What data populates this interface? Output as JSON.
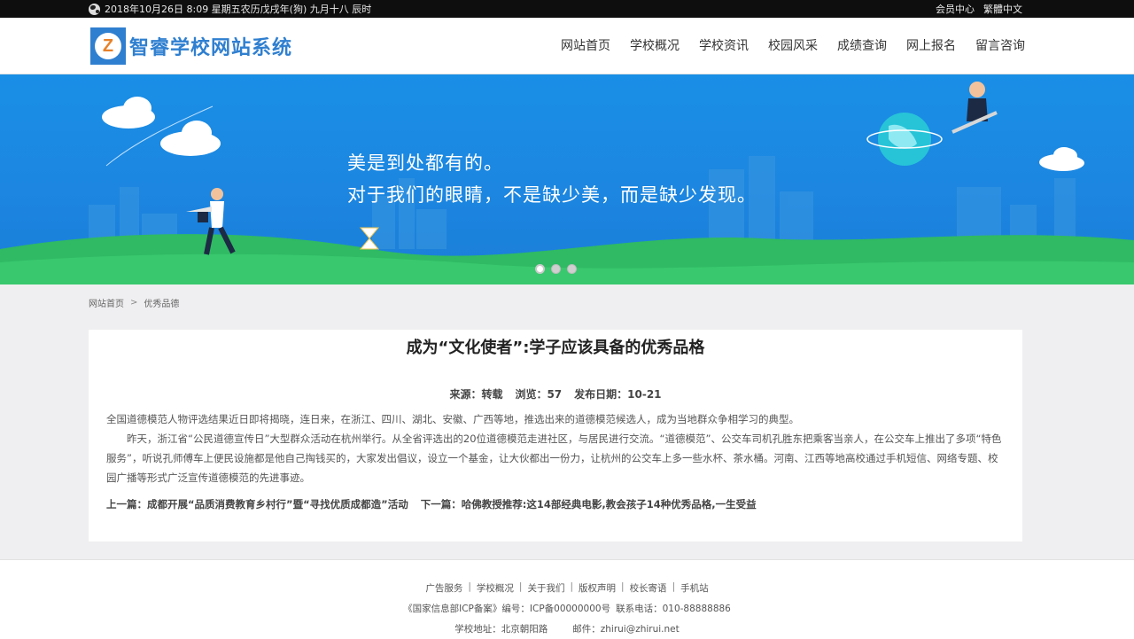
{
  "topbar": {
    "date_text": "2018年10月26日 8:09 星期五农历戊戌年(狗) 九月十八 辰时",
    "member_center": "会员中心",
    "traditional": "繁體中文"
  },
  "header": {
    "logo_letter": "Z",
    "logo_text": "智睿学校网站系统",
    "nav": [
      {
        "label": "网站首页"
      },
      {
        "label": "学校概况"
      },
      {
        "label": "学校资讯"
      },
      {
        "label": "校园风采"
      },
      {
        "label": "成绩查询"
      },
      {
        "label": "网上报名"
      },
      {
        "label": "留言咨询"
      }
    ]
  },
  "banner": {
    "line1": "美是到处都有的。",
    "line2": "对于我们的眼睛，不是缺少美，而是缺少发现。",
    "slides": 3,
    "active_slide": 1
  },
  "breadcrumb": {
    "home": "网站首页",
    "sep": ">",
    "current": "优秀品德"
  },
  "article": {
    "title": "成为“文化使者”:学子应该具备的优秀品格",
    "source_label": "来源：转载",
    "views_label": "浏览：57",
    "date_label": "发布日期：10-21",
    "p1": "全国道德模范人物评选结果近日即将揭晓，连日来，在浙江、四川、湖北、安徽、广西等地，推选出来的道德模范候选人，成为当地群众争相学习的典型。",
    "p2": "昨天，浙江省“公民道德宣传日”大型群众活动在杭州举行。从全省评选出的20位道德模范走进社区，与居民进行交流。“道德模范”、公交车司机孔胜东把乘客当亲人，在公交车上推出了多项“特色服务”，听说孔师傅车上便民设施都是他自己掏钱买的，大家发出倡议，设立一个基金，让大伙都出一份力，让杭州的公交车上多一些水杯、茶水桶。河南、江西等地高校通过手机短信、网络专题、校园广播等形式广泛宣传道德模范的先进事迹。",
    "prev": "上一篇：成都开展“品质消费教育乡村行”暨“寻找优质成都造”活动",
    "next": "下一篇：哈佛教授推荐:这14部经典电影,教会孩子14种优秀品格,一生受益"
  },
  "footer": {
    "links": [
      "广告服务",
      "学校概况",
      "关于我们",
      "版权声明",
      "校长寄语",
      "手机站"
    ],
    "separator": "|",
    "icp_label": "《国家信息部ICP备案》编号：ICP备00000000号",
    "phone": "联系电话：010-88888886",
    "address": "学校地址：北京朝阳路",
    "email": "邮件：zhirui@zhirui.net"
  },
  "colors": {
    "brand": "#2f7fd0",
    "banner_blue": "#1a8fe6",
    "grass": "#35c06a"
  }
}
